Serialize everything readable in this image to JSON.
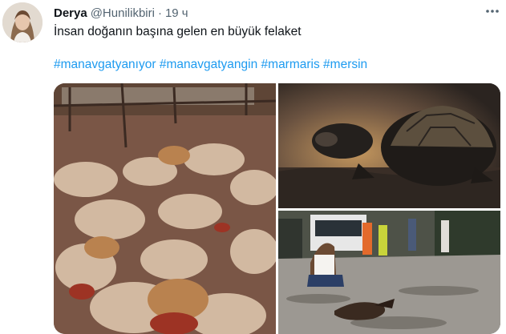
{
  "tweet": {
    "author_name": "Derya",
    "author_handle": "@Hunilikbiri",
    "separator": "·",
    "time": "19 ч",
    "text": "İnsan doğanın başına gelen en büyük felaket",
    "hashtags": [
      "#manavgatyanıyor",
      "#manavgatyangin",
      "#marmaris",
      "#mersin"
    ],
    "more_icon": "more-horizontal-icon"
  },
  "media": {
    "images": [
      {
        "name": "burned-sheep-photo"
      },
      {
        "name": "burned-tortoise-photo"
      },
      {
        "name": "crouching-woman-street-photo"
      }
    ]
  }
}
